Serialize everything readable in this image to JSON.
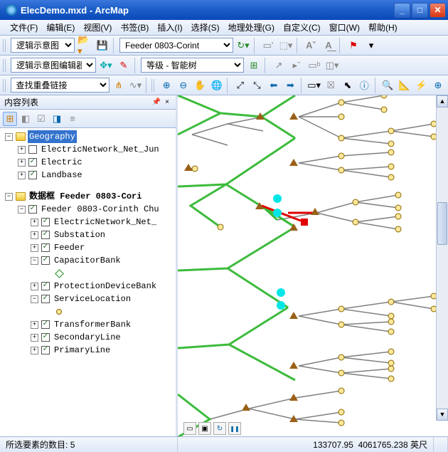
{
  "window": {
    "title": "ElecDemo.mxd - ArcMap"
  },
  "menu": {
    "file": "文件(F)",
    "edit": "编辑(E)",
    "view": "视图(V)",
    "bookmarks": "书签(B)",
    "insert": "插入(I)",
    "selection": "选择(S)",
    "geoprocessing": "地理处理(G)",
    "customize": "自定义(C)",
    "windows": "窗口(W)",
    "help": "帮助(H)"
  },
  "toolbar1": {
    "combo1": "逻辑示意图",
    "feeder_combo": "Feeder 0803-Corint"
  },
  "toolbar2": {
    "editor_label": "逻辑示意图编辑器",
    "level_combo": "等级 - 智能树"
  },
  "toolbar3": {
    "search_combo": "查找重叠链接"
  },
  "toc": {
    "title": "内容列表",
    "geo_label": "Geography",
    "geo_children": [
      "ElectricNetwork_Net_Jun",
      "Electric",
      "Landbase"
    ],
    "df_label": "数据框 Feeder 0803-Cori",
    "feeder_layer": "Feeder 0803-Corinth Chu",
    "feeder_children": [
      "ElectricNetwork_Net_",
      "Substation",
      "Feeder",
      "CapacitorBank",
      "ProtectionDeviceBank",
      "ServiceLocation",
      "TransformerBank",
      "SecondaryLine",
      "PrimaryLine"
    ]
  },
  "status": {
    "selected_label": "所选要素的数目:",
    "selected_count": "5",
    "coord_x": "133707.95",
    "coord_y": "4061765.238",
    "units": "英尺"
  },
  "icons": {
    "folder_open": "📂",
    "new_doc": "📄",
    "globe": "🌐",
    "hand": "✋",
    "arrow_ptr": "➤",
    "search": "🔍",
    "zoom_in": "⊕",
    "zoom_out": "⊖",
    "fullextent": "⤢",
    "refresh": "↻",
    "play": "▶",
    "pause": "❚❚"
  }
}
